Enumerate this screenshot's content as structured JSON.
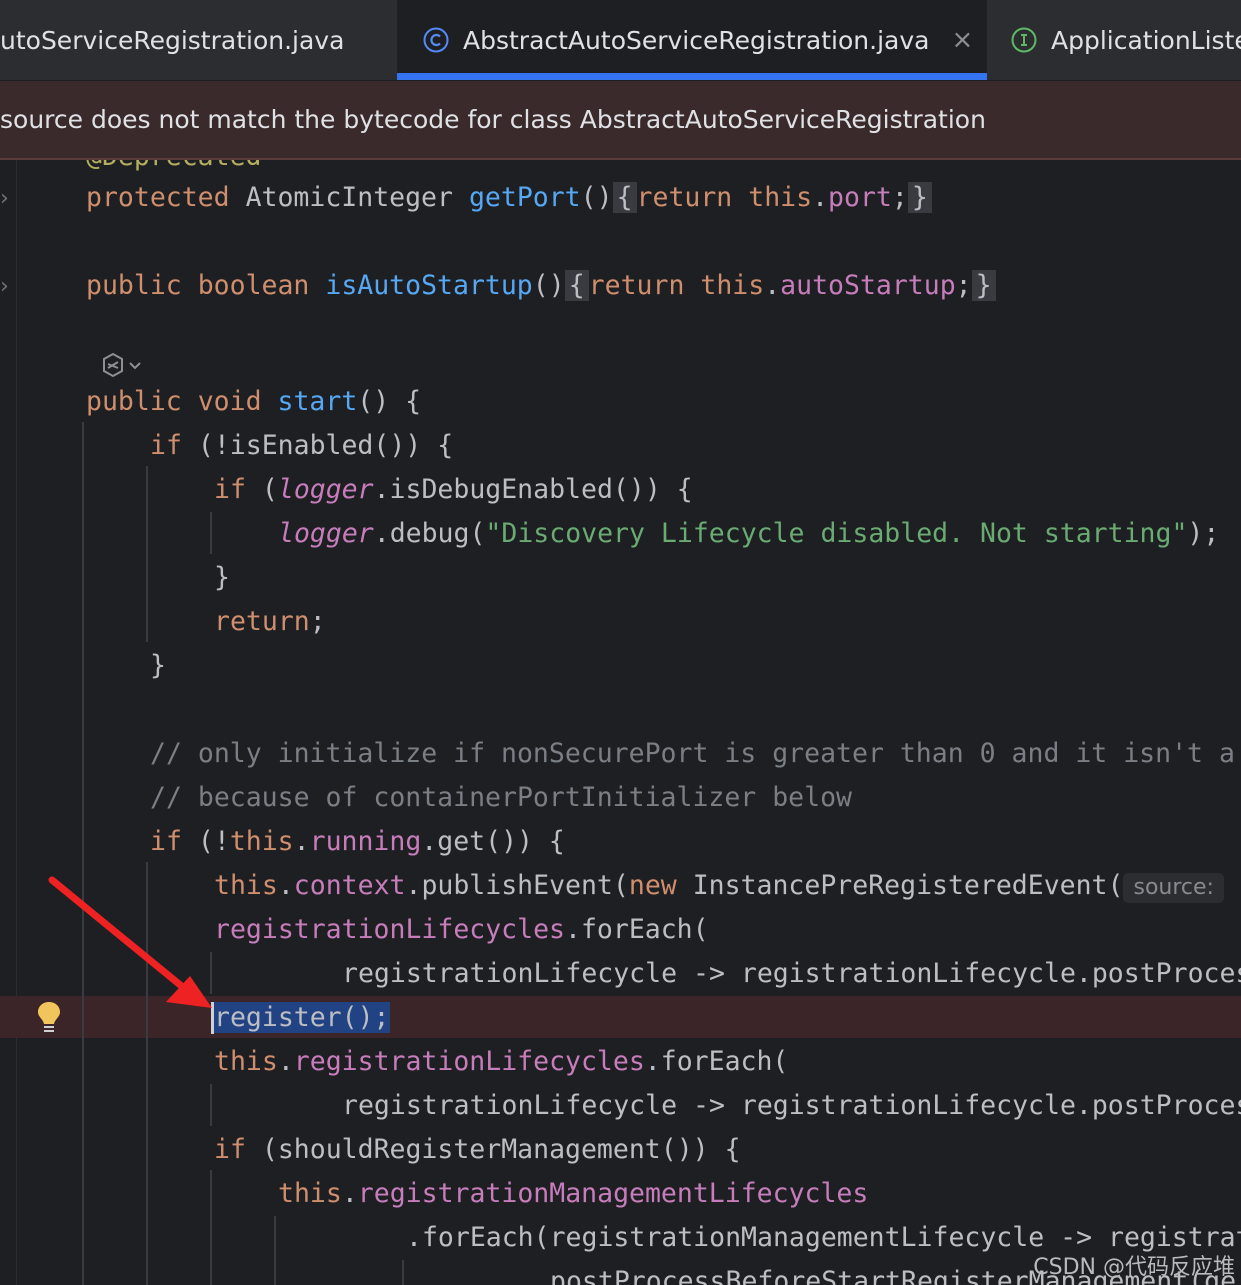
{
  "tabs": [
    {
      "label": "utoServiceRegistration.java",
      "active": false
    },
    {
      "label": "AbstractAutoServiceRegistration.java",
      "active": true,
      "icon": "class-icon",
      "close": "×"
    },
    {
      "label": "ApplicationListe",
      "active": false,
      "icon": "interface-icon"
    }
  ],
  "banner": {
    "message": "source does not match the bytecode for class AbstractAutoServiceRegistration"
  },
  "inlay": {
    "source_hint": "source:"
  },
  "watermark": "CSDN @代码反应堆",
  "colors": {
    "keyword": "#cf8e6d",
    "method": "#56a8f5",
    "field": "#c77dbb",
    "string": "#6aab73",
    "comment": "#7a7e85",
    "selection": "#214283",
    "arrow": "#ee2222"
  },
  "code": {
    "deprecated": "@Deprecated",
    "l1": {
      "kw": "protected",
      "type": "AtomicInteger",
      "fn": "getPort",
      "parens": "()",
      "ob": "{",
      "ret": "return",
      "this": "this",
      "dot": ".",
      "fld": "port",
      "semi": ";",
      "cb": "}"
    },
    "l2": {
      "kw": "public",
      "type": "boolean",
      "fn": "isAutoStartup",
      "parens": "()",
      "ob": "{",
      "ret": "return",
      "this": "this",
      "dot": ".",
      "fld": "autoStartup",
      "semi": ";",
      "cb": "}"
    },
    "l3": {
      "kw": "public",
      "type": "void",
      "fn": "start",
      "rest": "() {"
    },
    "l4": {
      "kw": "if",
      "rest": "(!isEnabled()) {"
    },
    "l5": {
      "kw": "if",
      "open": "(",
      "logger": "logger",
      "rest": ".isDebugEnabled()) {"
    },
    "l6": {
      "logger": "logger",
      "call": ".debug(",
      "str": "\"Discovery Lifecycle disabled. Not starting\"",
      "end": ");"
    },
    "l7": "}",
    "l8": {
      "kw": "return",
      "end": ";"
    },
    "l9": "}",
    "c1": "// only initialize if nonSecurePort is greater than 0 and it isn't a",
    "c2": "// because of containerPortInitializer below",
    "l10": {
      "kw": "if",
      "pre": "(!",
      "this": "this",
      "dot": ".",
      "fld": "running",
      "rest": ".get()) {"
    },
    "l11": {
      "this": "this",
      "dot": ".",
      "fld": "context",
      "call": ".publishEvent(",
      "new": "new",
      "rest": "InstancePreRegisteredEvent("
    },
    "l12": {
      "fld": "registrationLifecycles",
      "rest": ".forEach("
    },
    "l13": "registrationLifecycle -> registrationLifecycle.postProces",
    "l14": {
      "sel": "register();"
    },
    "l15": {
      "this": "this",
      "dot": ".",
      "fld": "registrationLifecycles",
      "rest": ".forEach("
    },
    "l16": "registrationLifecycle -> registrationLifecycle.postProces",
    "l17": {
      "kw": "if",
      "rest": "(shouldRegisterManagement()) {"
    },
    "l18": {
      "this": "this",
      "dot": ".",
      "fld": "registrationManagementLifecycles"
    },
    "l19": ".forEach(registrationManagementLifecycle -> registrat",
    "l20": "postProcessBeforeStartRegisterManagement(ge"
  }
}
